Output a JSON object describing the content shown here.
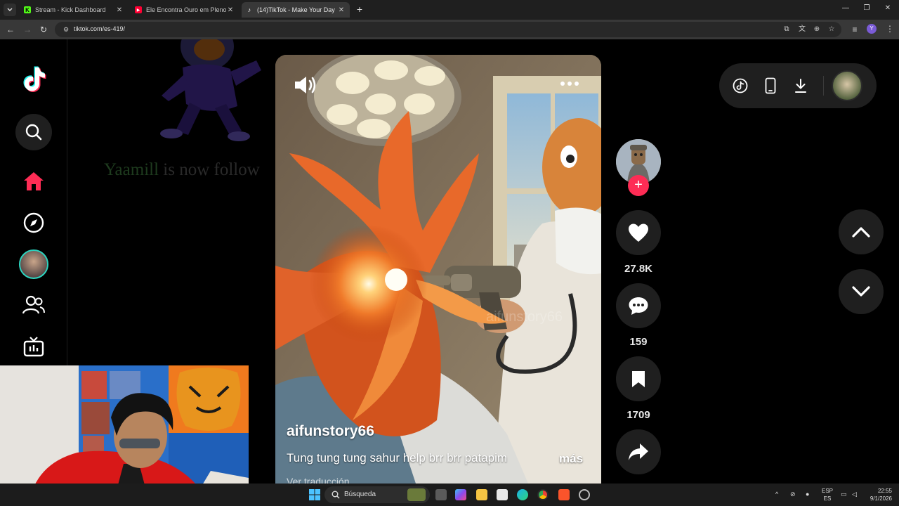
{
  "browser": {
    "tabs": [
      {
        "title": "Stream - Kick Dashboard",
        "favicon": "kick-icon",
        "color": "#53fc18",
        "active": false
      },
      {
        "title": "Ele Encontra Ouro em Pleno Dia",
        "favicon": "youtube-icon",
        "color": "#ff0033",
        "active": false
      },
      {
        "title": "(14)TikTok - Make Your Day",
        "favicon": "tiktok-icon",
        "color": "#ffffff",
        "active": true
      }
    ],
    "url": "tiktok.com/es-419/",
    "profile_initial": "Y"
  },
  "overlay": {
    "name": "Yaamill",
    "message": " is now follow"
  },
  "video": {
    "username": "aifunstory66",
    "caption": "Tung tung tung sahur help brr brr patapim",
    "more_label": "más",
    "sub_text": "Ver traducción",
    "watermark": "aifunstory66"
  },
  "actions": {
    "likes": "27.8K",
    "comments": "159",
    "saves": "1709"
  },
  "colors": {
    "accent": "#fe2c55",
    "teal": "#25f4ee"
  },
  "taskbar": {
    "search_label": "Búsqueda",
    "lang_top": "ESP",
    "lang_bottom": "ES",
    "time": "22:55",
    "date": "9/1/2026"
  }
}
